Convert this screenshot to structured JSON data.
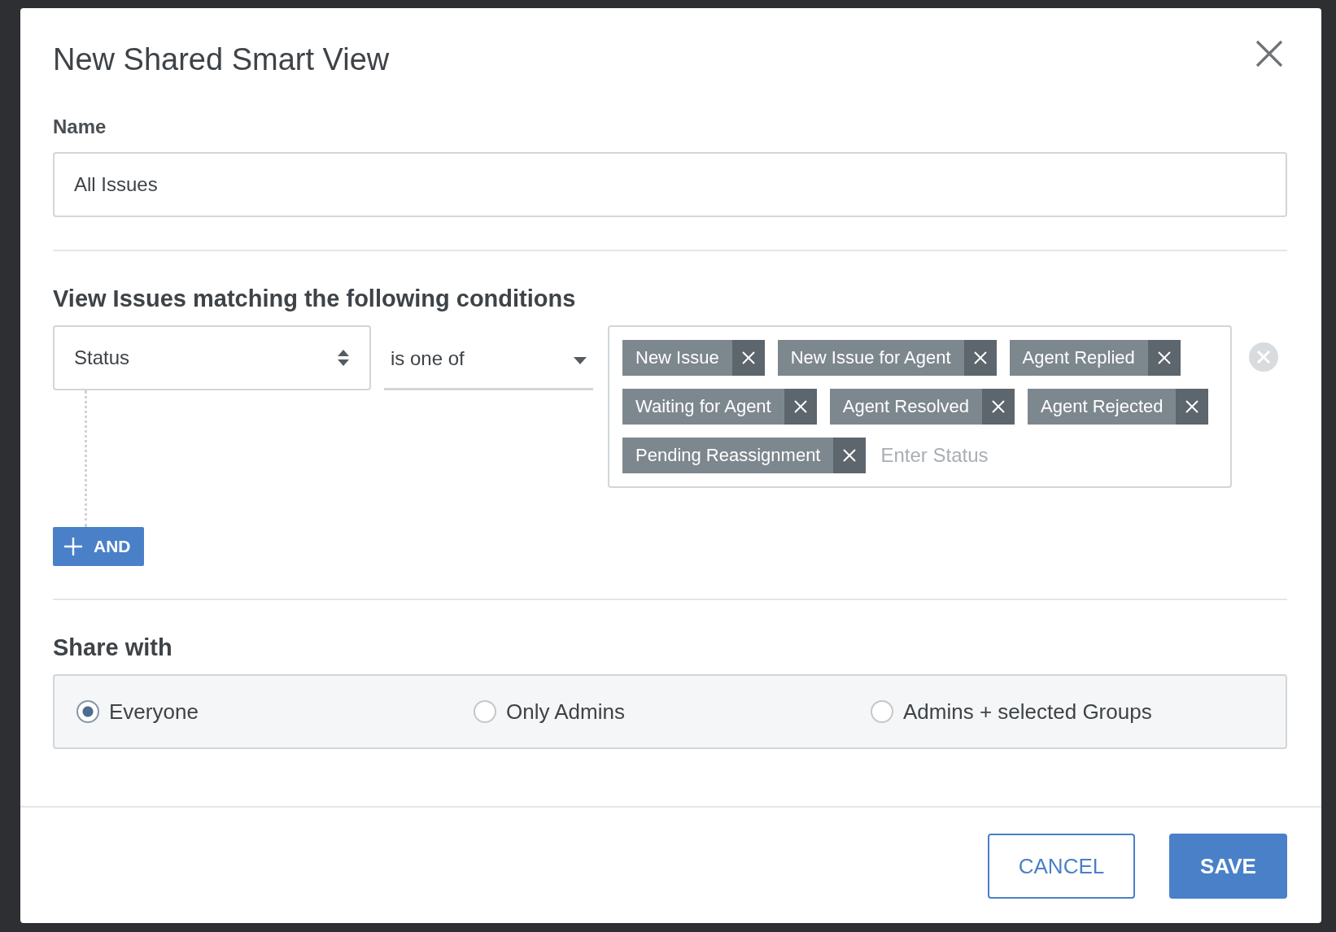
{
  "dialog": {
    "title": "New Shared Smart View"
  },
  "name_field": {
    "label": "Name",
    "value": "All Issues"
  },
  "conditions": {
    "heading": "View Issues matching the following conditions",
    "rows": [
      {
        "field": "Status",
        "operator": "is one of",
        "tags": [
          "New Issue",
          "New Issue for Agent",
          "Agent Replied",
          "Waiting for Agent",
          "Agent Resolved",
          "Agent Rejected",
          "Pending Reassignment"
        ],
        "placeholder": "Enter Status"
      }
    ],
    "add_button": "AND"
  },
  "share": {
    "heading": "Share with",
    "options": [
      {
        "label": "Everyone",
        "selected": true
      },
      {
        "label": "Only Admins",
        "selected": false
      },
      {
        "label": "Admins + selected Groups",
        "selected": false
      }
    ]
  },
  "buttons": [
    {
      "label": "CANCEL",
      "kind": "secondary"
    },
    {
      "label": "SAVE",
      "kind": "primary"
    }
  ]
}
